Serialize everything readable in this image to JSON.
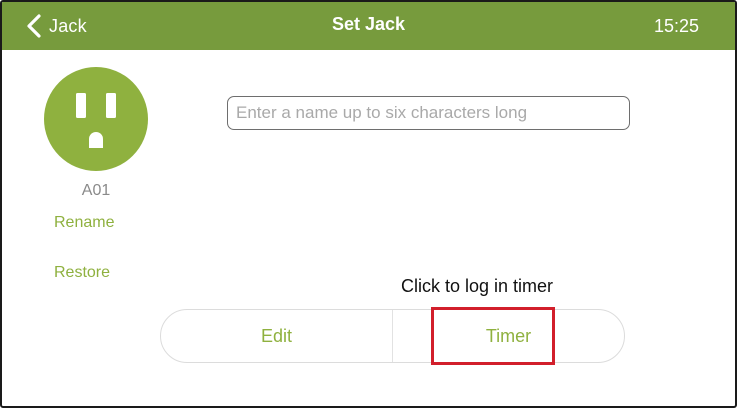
{
  "nav": {
    "back_label": "Jack",
    "back_icon": "chevron-left-icon",
    "title": "Set Jack",
    "time": "15:25"
  },
  "device": {
    "icon": "power-outlet-icon",
    "id": "A01",
    "rename_label": "Rename",
    "restore_label": "Restore"
  },
  "name_field": {
    "placeholder": "Enter a name up to six characters long",
    "value": ""
  },
  "annotation": "Click to log in timer",
  "segments": {
    "edit_label": "Edit",
    "timer_label": "Timer"
  },
  "colors": {
    "header": "#779b3d",
    "accent": "#8fb13f",
    "highlight": "#d21f2b"
  }
}
